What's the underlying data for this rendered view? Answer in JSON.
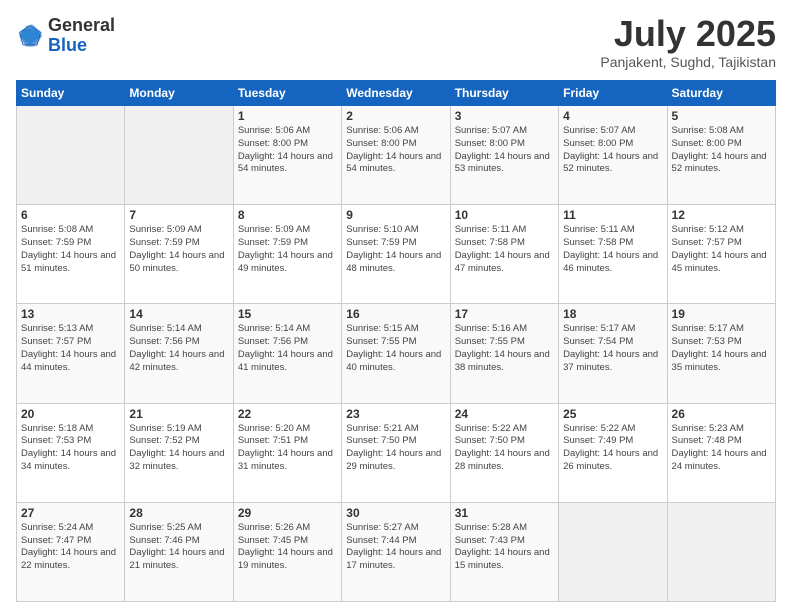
{
  "header": {
    "logo_general": "General",
    "logo_blue": "Blue",
    "month_title": "July 2025",
    "location": "Panjakent, Sughd, Tajikistan"
  },
  "weekdays": [
    "Sunday",
    "Monday",
    "Tuesday",
    "Wednesday",
    "Thursday",
    "Friday",
    "Saturday"
  ],
  "weeks": [
    [
      {
        "day": "",
        "info": ""
      },
      {
        "day": "",
        "info": ""
      },
      {
        "day": "1",
        "info": "Sunrise: 5:06 AM\nSunset: 8:00 PM\nDaylight: 14 hours and 54 minutes."
      },
      {
        "day": "2",
        "info": "Sunrise: 5:06 AM\nSunset: 8:00 PM\nDaylight: 14 hours and 54 minutes."
      },
      {
        "day": "3",
        "info": "Sunrise: 5:07 AM\nSunset: 8:00 PM\nDaylight: 14 hours and 53 minutes."
      },
      {
        "day": "4",
        "info": "Sunrise: 5:07 AM\nSunset: 8:00 PM\nDaylight: 14 hours and 52 minutes."
      },
      {
        "day": "5",
        "info": "Sunrise: 5:08 AM\nSunset: 8:00 PM\nDaylight: 14 hours and 52 minutes."
      }
    ],
    [
      {
        "day": "6",
        "info": "Sunrise: 5:08 AM\nSunset: 7:59 PM\nDaylight: 14 hours and 51 minutes."
      },
      {
        "day": "7",
        "info": "Sunrise: 5:09 AM\nSunset: 7:59 PM\nDaylight: 14 hours and 50 minutes."
      },
      {
        "day": "8",
        "info": "Sunrise: 5:09 AM\nSunset: 7:59 PM\nDaylight: 14 hours and 49 minutes."
      },
      {
        "day": "9",
        "info": "Sunrise: 5:10 AM\nSunset: 7:59 PM\nDaylight: 14 hours and 48 minutes."
      },
      {
        "day": "10",
        "info": "Sunrise: 5:11 AM\nSunset: 7:58 PM\nDaylight: 14 hours and 47 minutes."
      },
      {
        "day": "11",
        "info": "Sunrise: 5:11 AM\nSunset: 7:58 PM\nDaylight: 14 hours and 46 minutes."
      },
      {
        "day": "12",
        "info": "Sunrise: 5:12 AM\nSunset: 7:57 PM\nDaylight: 14 hours and 45 minutes."
      }
    ],
    [
      {
        "day": "13",
        "info": "Sunrise: 5:13 AM\nSunset: 7:57 PM\nDaylight: 14 hours and 44 minutes."
      },
      {
        "day": "14",
        "info": "Sunrise: 5:14 AM\nSunset: 7:56 PM\nDaylight: 14 hours and 42 minutes."
      },
      {
        "day": "15",
        "info": "Sunrise: 5:14 AM\nSunset: 7:56 PM\nDaylight: 14 hours and 41 minutes."
      },
      {
        "day": "16",
        "info": "Sunrise: 5:15 AM\nSunset: 7:55 PM\nDaylight: 14 hours and 40 minutes."
      },
      {
        "day": "17",
        "info": "Sunrise: 5:16 AM\nSunset: 7:55 PM\nDaylight: 14 hours and 38 minutes."
      },
      {
        "day": "18",
        "info": "Sunrise: 5:17 AM\nSunset: 7:54 PM\nDaylight: 14 hours and 37 minutes."
      },
      {
        "day": "19",
        "info": "Sunrise: 5:17 AM\nSunset: 7:53 PM\nDaylight: 14 hours and 35 minutes."
      }
    ],
    [
      {
        "day": "20",
        "info": "Sunrise: 5:18 AM\nSunset: 7:53 PM\nDaylight: 14 hours and 34 minutes."
      },
      {
        "day": "21",
        "info": "Sunrise: 5:19 AM\nSunset: 7:52 PM\nDaylight: 14 hours and 32 minutes."
      },
      {
        "day": "22",
        "info": "Sunrise: 5:20 AM\nSunset: 7:51 PM\nDaylight: 14 hours and 31 minutes."
      },
      {
        "day": "23",
        "info": "Sunrise: 5:21 AM\nSunset: 7:50 PM\nDaylight: 14 hours and 29 minutes."
      },
      {
        "day": "24",
        "info": "Sunrise: 5:22 AM\nSunset: 7:50 PM\nDaylight: 14 hours and 28 minutes."
      },
      {
        "day": "25",
        "info": "Sunrise: 5:22 AM\nSunset: 7:49 PM\nDaylight: 14 hours and 26 minutes."
      },
      {
        "day": "26",
        "info": "Sunrise: 5:23 AM\nSunset: 7:48 PM\nDaylight: 14 hours and 24 minutes."
      }
    ],
    [
      {
        "day": "27",
        "info": "Sunrise: 5:24 AM\nSunset: 7:47 PM\nDaylight: 14 hours and 22 minutes."
      },
      {
        "day": "28",
        "info": "Sunrise: 5:25 AM\nSunset: 7:46 PM\nDaylight: 14 hours and 21 minutes."
      },
      {
        "day": "29",
        "info": "Sunrise: 5:26 AM\nSunset: 7:45 PM\nDaylight: 14 hours and 19 minutes."
      },
      {
        "day": "30",
        "info": "Sunrise: 5:27 AM\nSunset: 7:44 PM\nDaylight: 14 hours and 17 minutes."
      },
      {
        "day": "31",
        "info": "Sunrise: 5:28 AM\nSunset: 7:43 PM\nDaylight: 14 hours and 15 minutes."
      },
      {
        "day": "",
        "info": ""
      },
      {
        "day": "",
        "info": ""
      }
    ]
  ]
}
